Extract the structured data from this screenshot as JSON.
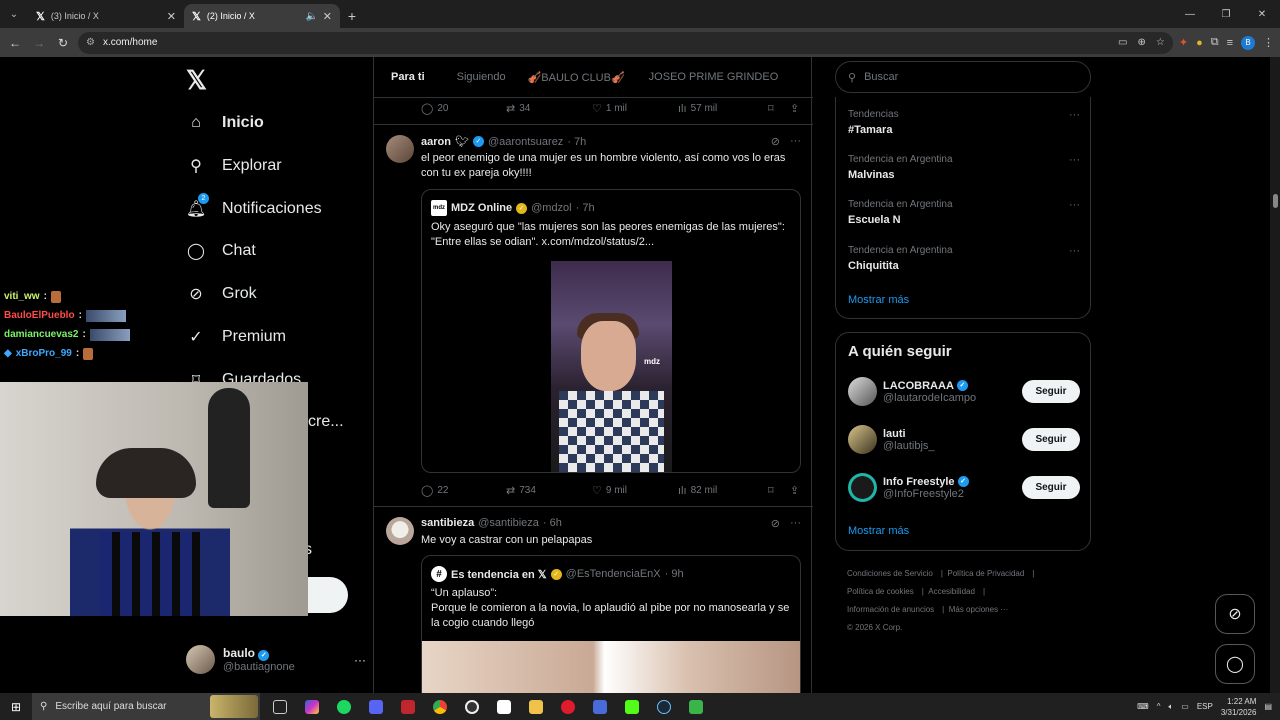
{
  "browser": {
    "tabs": [
      {
        "title": "(3) Inicio / X",
        "active": false
      },
      {
        "title": "(2) Inicio / X",
        "active": true
      }
    ],
    "url": "x.com/home"
  },
  "nav": {
    "items": [
      {
        "label": "Inicio",
        "icon": "home-icon"
      },
      {
        "label": "Explorar",
        "icon": "search-icon"
      },
      {
        "label": "Notificaciones",
        "icon": "bell-icon",
        "badge": "2"
      },
      {
        "label": "Chat",
        "icon": "chat-icon"
      },
      {
        "label": "Grok",
        "icon": "grok-icon"
      },
      {
        "label": "Premium",
        "icon": "premium-icon"
      },
      {
        "label": "Guardados",
        "icon": "bookmark-icon"
      }
    ],
    "partial_label": "cre...",
    "partial_label2": "s",
    "account": {
      "name": "baulo",
      "handle": "@bautiagnone"
    }
  },
  "stream_chat": [
    {
      "user": "viti_ww",
      "sep": ":"
    },
    {
      "user": "BauloElPueblo",
      "sep": ":"
    },
    {
      "user": "damiancuevas2",
      "sep": ":"
    },
    {
      "user": "xBroPro_99",
      "sep": ":"
    }
  ],
  "timeline": {
    "tabs": [
      "Para ti",
      "Siguiendo",
      "🎻BAULO CLUB🎻",
      "JOSEO PRIME GRINDEO"
    ],
    "top_actions": {
      "replies": "20",
      "reposts": "34",
      "likes": "1 mil",
      "views": "57 mil"
    },
    "post1": {
      "name": "aaron",
      "handle": "@aarontsuarez",
      "time": "· 7h",
      "text": "el peor enemigo de una mujer es un hombre violento, así como vos lo eras con tu ex pareja oky!!!!",
      "quote": {
        "logo": "mdz",
        "name": "MDZ Online",
        "handle": "@mdzol",
        "time": "· 7h",
        "text": "Oky aseguró que \"las mujeres son las peores enemigas de las mujeres\": \"Entre ellas se odian\".  x.com/mdzol/status/2...",
        "video_watermark": "mdz"
      },
      "actions": {
        "replies": "22",
        "reposts": "734",
        "likes": "9 mil",
        "views": "82 mil"
      }
    },
    "post2": {
      "name": "santibieza",
      "handle": "@santibieza",
      "time": "· 6h",
      "text": "Me voy a castrar con un pelapapas",
      "quote": {
        "name": "Es tendencia en 𝕏",
        "handle": "@EsTendenciaEnX",
        "time": "· 9h",
        "text_l1": "“Un aplauso”:",
        "text_l2": "Porque le comieron a la novia, lo aplaudió al pibe por no manosearla y se la cogio cuando llegó"
      }
    }
  },
  "right": {
    "search_placeholder": "Buscar",
    "trends": [
      {
        "context": "Tendencias",
        "topic": "#Tamara"
      },
      {
        "context": "Tendencia en Argentina",
        "topic": "Malvinas"
      },
      {
        "context": "Tendencia en Argentina",
        "topic": "Escuela N"
      },
      {
        "context": "Tendencia en Argentina",
        "topic": "Chiquitita"
      }
    ],
    "show_more": "Mostrar más",
    "follow_title": "A quién seguir",
    "who": [
      {
        "name": "LACOBRAAA",
        "handle": "@lautarodeIcampo",
        "verified": true,
        "button": "Seguir"
      },
      {
        "name": "lauti",
        "handle": "@lautibjs_",
        "verified": false,
        "button": "Seguir"
      },
      {
        "name": "Info Freestyle",
        "handle": "@InfoFreestyle2",
        "verified": true,
        "button": "Seguir"
      }
    ],
    "follow_more": "Mostrar más",
    "footer": [
      "Condiciones de Servicio",
      "Política de Privacidad",
      "Política de cookies",
      "Accesibilidad",
      "Información de anuncios",
      "Más opciones ···",
      "© 2026 X Corp."
    ]
  },
  "taskbar": {
    "search_placeholder": "Escribe aquí para buscar",
    "language": "ESP",
    "time": "1:22 AM",
    "date": "3/31/2026"
  },
  "colors": {
    "accent": "#1d9bf0",
    "background": "#000000",
    "border": "#2f3336",
    "muted": "#71767b"
  }
}
